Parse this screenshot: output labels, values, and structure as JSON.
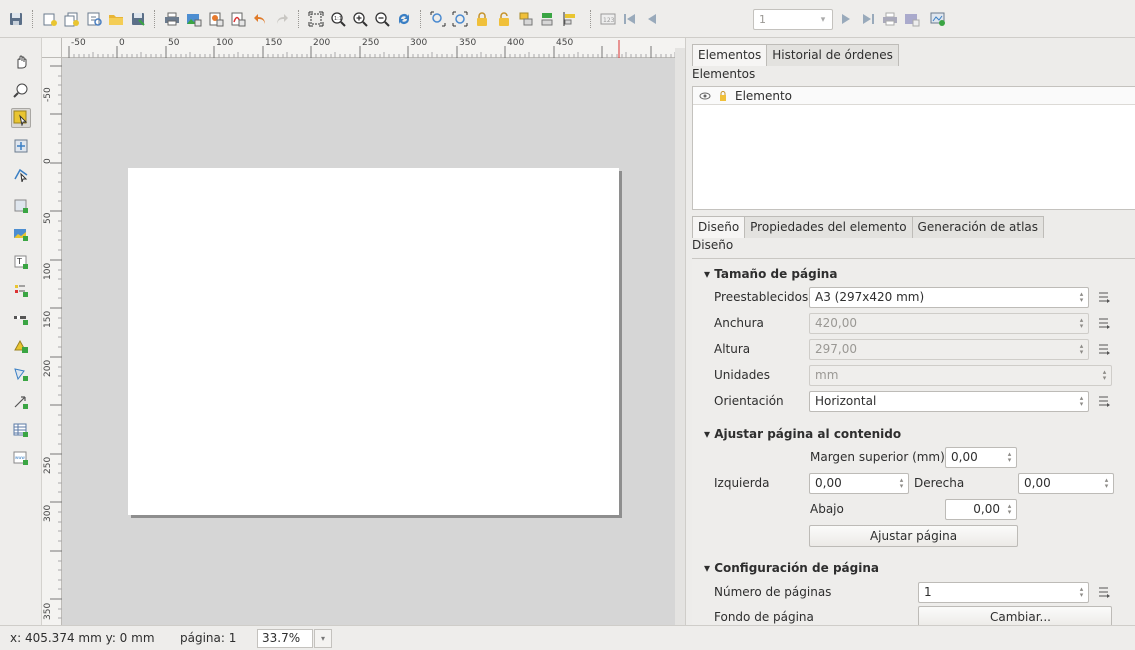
{
  "toolbar": {
    "page_number": "1"
  },
  "ruler": {
    "top_labels": [
      "-50",
      "0",
      "50",
      "100",
      "150",
      "200",
      "250",
      "300",
      "350",
      "400",
      "450"
    ],
    "left_labels": [
      "-50",
      "0",
      "50",
      "100",
      "150",
      "200",
      "250",
      "300",
      "350"
    ]
  },
  "right_panel": {
    "top_tabs": [
      "Elementos",
      "Historial de órdenes"
    ],
    "elements_label": "Elementos",
    "element_column": "Elemento",
    "bottom_tabs": [
      "Diseño",
      "Propiedades del elemento",
      "Generación de atlas"
    ],
    "design_label": "Diseño",
    "page_size": {
      "title": "Tamaño de página",
      "presets_label": "Preestablecidos",
      "presets_value": "A3 (297x420 mm)",
      "width_label": "Anchura",
      "width_value": "420,00",
      "height_label": "Altura",
      "height_value": "297,00",
      "units_label": "Unidades",
      "units_value": "mm",
      "orientation_label": "Orientación",
      "orientation_value": "Horizontal"
    },
    "fit": {
      "title": "Ajustar página al contenido",
      "top_margin_label": "Margen superior (mm)",
      "top_margin_value": "0,00",
      "left_label": "Izquierda",
      "left_value": "0,00",
      "right_label": "Derecha",
      "right_value": "0,00",
      "bottom_label": "Abajo",
      "bottom_value": "0,00",
      "button": "Ajustar página"
    },
    "page_config": {
      "title": "Configuración de página",
      "pages_label": "Número de páginas",
      "pages_value": "1",
      "background_label": "Fondo de página",
      "background_button": "Cambiar..."
    }
  },
  "status": {
    "coords": "x: 405.374 mm y: 0 mm",
    "page": "página: 1",
    "zoom": "33.7%"
  }
}
